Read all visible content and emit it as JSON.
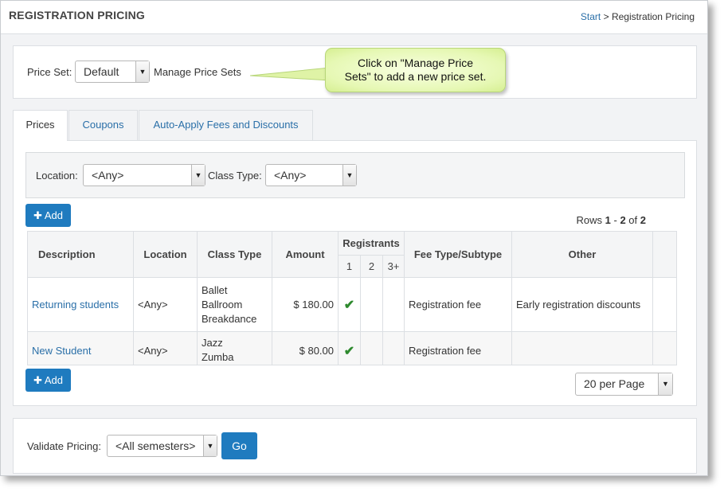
{
  "header": {
    "title": "REGISTRATION PRICING",
    "breadcrumb_start": "Start",
    "breadcrumb_sep": ">",
    "breadcrumb_current": "Registration Pricing"
  },
  "price_set": {
    "label": "Price Set:",
    "value": "Default",
    "manage_link": "Manage Price Sets"
  },
  "callout": {
    "line1": "Click on \"Manage Price",
    "line2": "Sets\" to add a new price set."
  },
  "tabs": [
    {
      "label": "Prices",
      "active": true
    },
    {
      "label": "Coupons",
      "active": false
    },
    {
      "label": "Auto-Apply Fees and Discounts",
      "active": false
    }
  ],
  "filters": {
    "location_label": "Location:",
    "location_value": "<Any>",
    "class_type_label": "Class Type:",
    "class_type_value": "<Any>"
  },
  "add_label": "Add",
  "rows_info": {
    "prefix": "Rows",
    "from": "1",
    "dash": "-",
    "to": "2",
    "of": "of",
    "total": "2"
  },
  "table": {
    "headers": {
      "description": "Description",
      "location": "Location",
      "class_type": "Class Type",
      "amount": "Amount",
      "registrants": "Registrants",
      "reg1": "1",
      "reg2": "2",
      "reg3": "3+",
      "fee_type": "Fee Type/Subtype",
      "other": "Other"
    },
    "rows": [
      {
        "description": "Returning students",
        "location": "<Any>",
        "class_types": [
          "Ballet",
          "Ballroom",
          "Breakdance"
        ],
        "amount": "$ 180.00",
        "fee_type": "Registration fee",
        "other": "Early registration discounts"
      },
      {
        "description": "New Student",
        "location": "<Any>",
        "class_types": [
          "Jazz",
          "Zumba"
        ],
        "amount": "$ 80.00",
        "fee_type": "Registration fee",
        "other": ""
      }
    ]
  },
  "per_page": "20 per Page",
  "validate": {
    "label": "Validate Pricing:",
    "value": "<All semesters>",
    "go_label": "Go"
  },
  "icons": {
    "check": "check-icon",
    "plus": "plus-icon",
    "dropdown": "caret-down-icon"
  },
  "colors": {
    "link": "#2a6fa8",
    "primary_button": "#1f7bbf",
    "check": "#2e8a2e",
    "callout": "#e6f8b4"
  }
}
